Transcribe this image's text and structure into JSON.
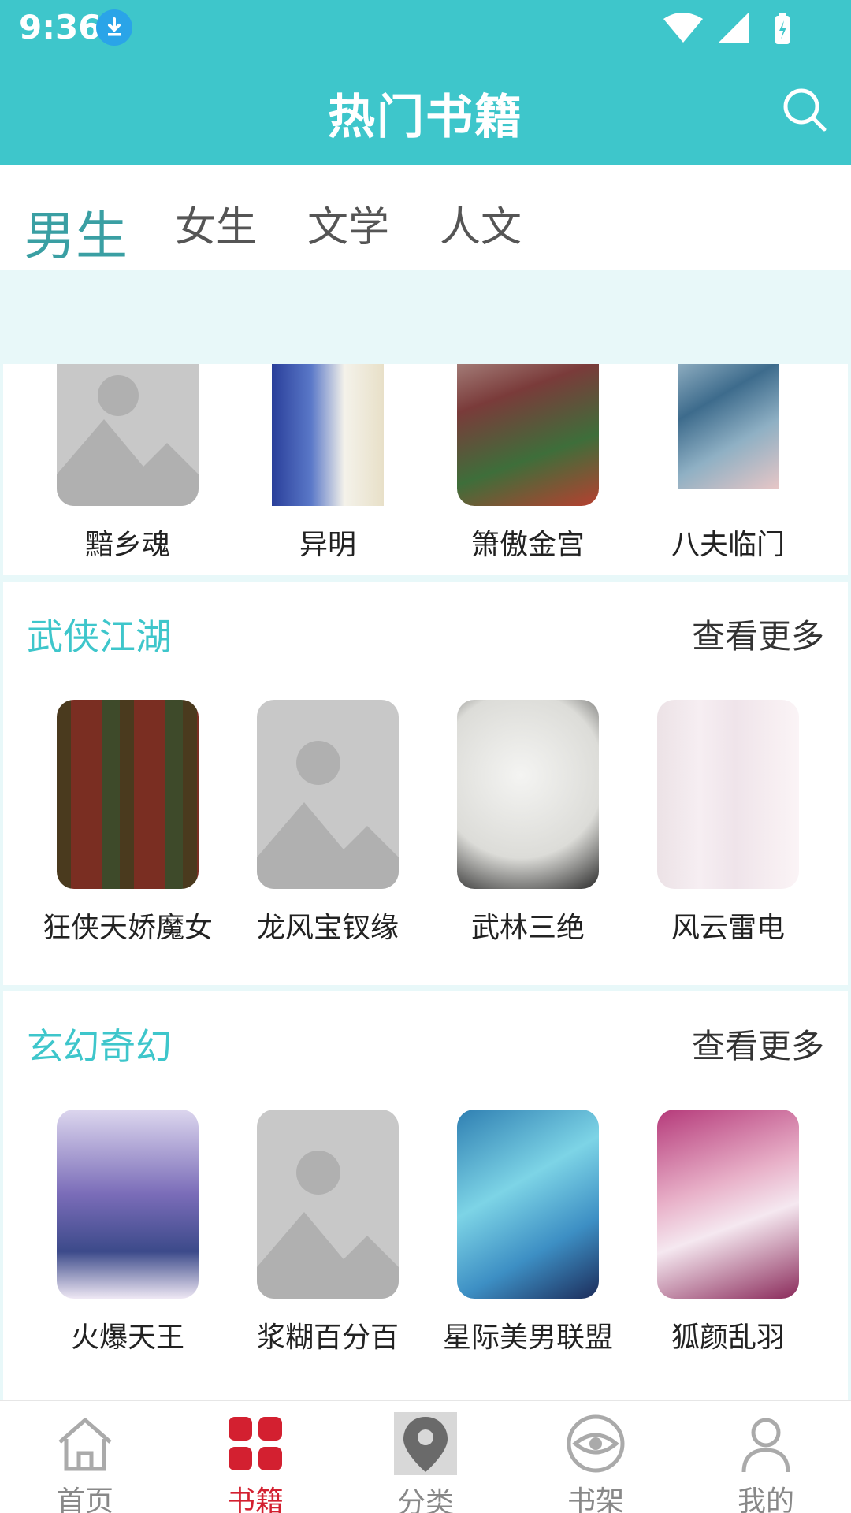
{
  "status_bar": {
    "time": "9:36"
  },
  "header": {
    "title": "热门书籍"
  },
  "tabs": [
    {
      "label": "男生",
      "active": true
    },
    {
      "label": "女生",
      "active": false
    },
    {
      "label": "文学",
      "active": false
    },
    {
      "label": "人文",
      "active": false
    }
  ],
  "sections": [
    {
      "books": [
        {
          "title": "黯乡魂",
          "cover": "placeholder"
        },
        {
          "title": "异明",
          "cover": "blue-white"
        },
        {
          "title": "箫傲金宫",
          "cover": "red-green"
        },
        {
          "title": "八夫临门",
          "cover": "teal-blue"
        }
      ]
    },
    {
      "title": "武侠江湖",
      "more": "查看更多",
      "books": [
        {
          "title": "狂侠天娇魔女",
          "cover": "dark-gold"
        },
        {
          "title": "龙风宝钗缘",
          "cover": "placeholder"
        },
        {
          "title": "武林三绝",
          "cover": "paper-white"
        },
        {
          "title": "风云雷电",
          "cover": "pink-white"
        }
      ]
    },
    {
      "title": "玄幻奇幻",
      "more": "查看更多",
      "books": [
        {
          "title": "火爆天王",
          "cover": "purple-blue"
        },
        {
          "title": "浆糊百分百",
          "cover": "placeholder"
        },
        {
          "title": "星际美男联盟",
          "cover": "aqua"
        },
        {
          "title": "狐颜乱羽",
          "cover": "magenta"
        }
      ]
    }
  ],
  "bottom_nav": [
    {
      "label": "首页",
      "icon": "home-icon",
      "active": false
    },
    {
      "label": "书籍",
      "icon": "grid-icon",
      "active": true
    },
    {
      "label": "分类",
      "icon": "location-pin-icon",
      "active": false
    },
    {
      "label": "书架",
      "icon": "eye-icon",
      "active": false
    },
    {
      "label": "我的",
      "icon": "user-icon",
      "active": false
    }
  ],
  "colors": {
    "accent": "#3ec6cb",
    "active_nav": "#d32030",
    "tab_active": "#3a9fa3"
  }
}
